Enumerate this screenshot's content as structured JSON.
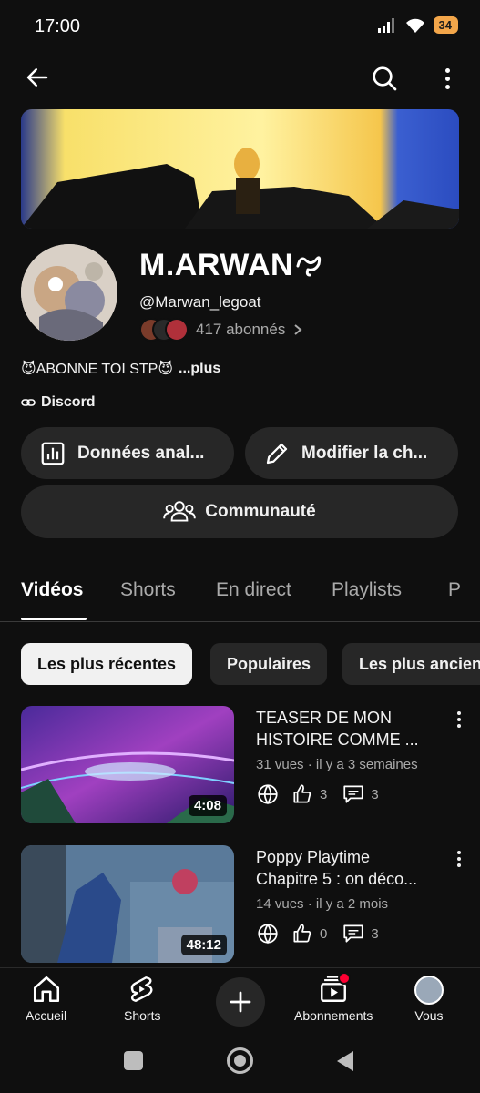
{
  "status_bar": {
    "time": "17:00",
    "battery": "34"
  },
  "channel": {
    "name": "M.ARWAN",
    "handle": "@Marwan_legoat",
    "subscribers": "417 abonnés",
    "description": "😈ABONNE TOI STP😈",
    "more": "...plus",
    "link_label": "Discord"
  },
  "buttons": {
    "analytics": "Données anal...",
    "edit": "Modifier la ch...",
    "community": "Communauté"
  },
  "tabs": [
    "Vidéos",
    "Shorts",
    "En direct",
    "Playlists",
    "P"
  ],
  "chips": [
    "Les plus récentes",
    "Populaires",
    "Les plus ancien"
  ],
  "videos": [
    {
      "title_line1": "TEASER DE MON",
      "title_line2": "HISTOIRE COMME ...",
      "meta": "31 vues · il y a 3 semaines",
      "likes": "3",
      "comments": "3",
      "duration": "4:08"
    },
    {
      "title_line1": "Poppy Playtime",
      "title_line2": "Chapitre 5 : on déco...",
      "meta": "14 vues · il y a 2 mois",
      "likes": "0",
      "comments": "3",
      "duration": "48:12"
    }
  ],
  "bottom_nav": {
    "home": "Accueil",
    "shorts": "Shorts",
    "subscriptions": "Abonnements",
    "you": "Vous"
  },
  "colors": {
    "background": "#0f0f0f",
    "surface": "#272727",
    "text": "#f1f1f1",
    "secondary_text": "#aaaaaa",
    "battery": "#f3a64a",
    "notification_dot": "#ff0033"
  },
  "icons": [
    "back-arrow-icon",
    "search-icon",
    "more-vert-icon",
    "analytics-icon",
    "pencil-icon",
    "people-icon",
    "link-icon",
    "globe-icon",
    "thumbs-up-icon",
    "comment-icon",
    "home-icon",
    "shorts-icon",
    "plus-icon",
    "subscriptions-icon"
  ]
}
